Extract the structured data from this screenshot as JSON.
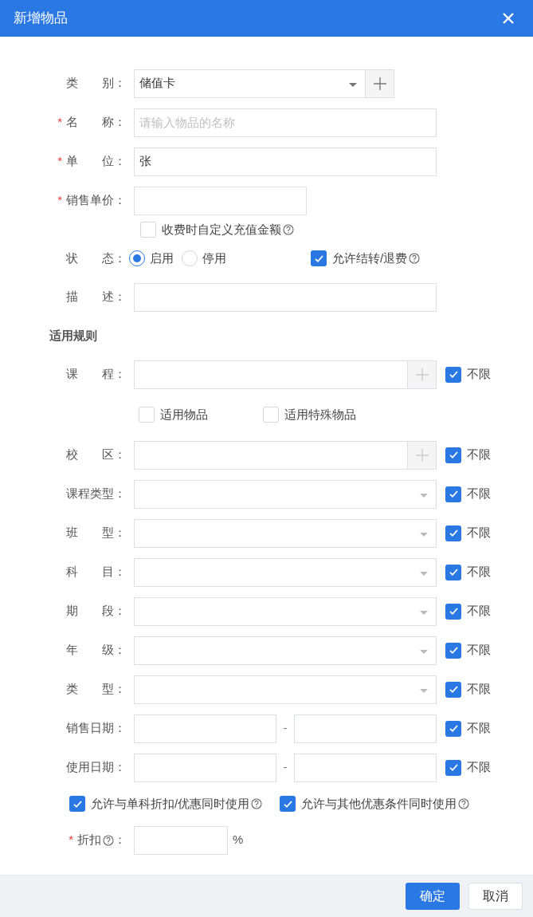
{
  "dialog": {
    "title": "新增物品"
  },
  "basic_rows": [
    {
      "kind": "select_add",
      "label": "类　　别：",
      "value": "储值卡"
    },
    {
      "kind": "text",
      "label": "名　　称：",
      "mark": "*",
      "placeholder": "请输入物品的名称"
    },
    {
      "kind": "text",
      "label": "单　　位：",
      "mark": "*",
      "value": "张"
    },
    {
      "kind": "short_text",
      "label": "销售单价：",
      "mark": "*"
    },
    {
      "kind": "checkbox",
      "options": [
        {
          "label": "收费时自定义充值金额",
          "checked": false,
          "help": true
        }
      ]
    },
    {
      "kind": "radio",
      "label": "状　　态：",
      "options": [
        {
          "label": "启用",
          "selected": true
        },
        {
          "label": "停用",
          "selected": false
        }
      ],
      "extra": {
        "label": "允许结转/退费",
        "checked": true,
        "help": true
      }
    },
    {
      "kind": "text",
      "label": "描　　述："
    }
  ],
  "section_title": "适用规则",
  "rule_rows": [
    {
      "kind": "picker",
      "label": "课　　程：",
      "unlimited": {
        "label": "不限",
        "checked": true
      }
    },
    {
      "kind": "checkbox",
      "options": [
        {
          "label": "适用物品",
          "checked": false
        },
        {
          "label": "适用特殊物品",
          "checked": false
        }
      ]
    },
    {
      "kind": "picker",
      "label": "校　　区：",
      "unlimited": {
        "label": "不限",
        "checked": true
      }
    },
    {
      "kind": "select",
      "label": "课程类型：",
      "unlimited": {
        "label": "不限",
        "checked": true
      }
    },
    {
      "kind": "select",
      "label": "班　　型：",
      "unlimited": {
        "label": "不限",
        "checked": true
      }
    },
    {
      "kind": "select",
      "label": "科　　目：",
      "unlimited": {
        "label": "不限",
        "checked": true
      }
    },
    {
      "kind": "select",
      "label": "期　　段：",
      "unlimited": {
        "label": "不限",
        "checked": true
      }
    },
    {
      "kind": "select",
      "label": "年　　级：",
      "unlimited": {
        "label": "不限",
        "checked": true
      }
    },
    {
      "kind": "select",
      "label": "类　　型：",
      "unlimited": {
        "label": "不限",
        "checked": true
      }
    },
    {
      "kind": "date_range",
      "label": "销售日期：",
      "separator": "-",
      "unlimited": {
        "label": "不限",
        "checked": true
      }
    },
    {
      "kind": "date_range",
      "label": "使用日期：",
      "separator": "-",
      "unlimited": {
        "label": "不限",
        "checked": true
      }
    },
    {
      "kind": "allow",
      "options": [
        {
          "label": "允许与单科折扣/优惠同时使用",
          "checked": true,
          "help": true
        },
        {
          "label": "允许与其他优惠条件同时使用",
          "checked": true,
          "help": true
        }
      ]
    },
    {
      "kind": "discount",
      "label": "折扣",
      "label_suffix": "：",
      "mark": "*",
      "help": true,
      "unit": "%"
    }
  ],
  "footer_buttons": [
    {
      "label": "确定",
      "kind": "primary"
    },
    {
      "label": "取消",
      "kind": "default"
    }
  ]
}
